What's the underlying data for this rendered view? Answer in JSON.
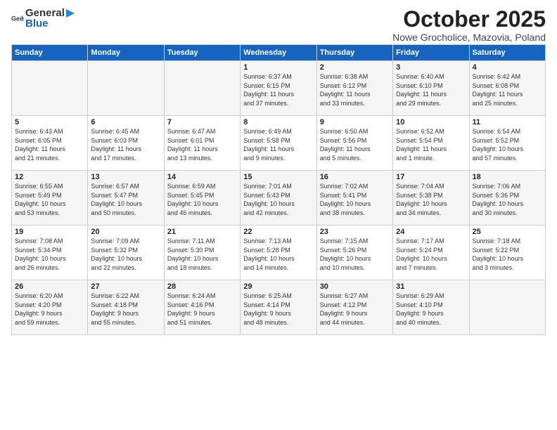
{
  "header": {
    "logo_general": "General",
    "logo_blue": "Blue",
    "month": "October 2025",
    "location": "Nowe Grocholice, Mazovia, Poland"
  },
  "days_of_week": [
    "Sunday",
    "Monday",
    "Tuesday",
    "Wednesday",
    "Thursday",
    "Friday",
    "Saturday"
  ],
  "weeks": [
    [
      {
        "day": "",
        "info": ""
      },
      {
        "day": "",
        "info": ""
      },
      {
        "day": "",
        "info": ""
      },
      {
        "day": "1",
        "info": "Sunrise: 6:37 AM\nSunset: 6:15 PM\nDaylight: 11 hours\nand 37 minutes."
      },
      {
        "day": "2",
        "info": "Sunrise: 6:38 AM\nSunset: 6:12 PM\nDaylight: 11 hours\nand 33 minutes."
      },
      {
        "day": "3",
        "info": "Sunrise: 6:40 AM\nSunset: 6:10 PM\nDaylight: 11 hours\nand 29 minutes."
      },
      {
        "day": "4",
        "info": "Sunrise: 6:42 AM\nSunset: 6:08 PM\nDaylight: 11 hours\nand 25 minutes."
      }
    ],
    [
      {
        "day": "5",
        "info": "Sunrise: 6:43 AM\nSunset: 6:05 PM\nDaylight: 11 hours\nand 21 minutes."
      },
      {
        "day": "6",
        "info": "Sunrise: 6:45 AM\nSunset: 6:03 PM\nDaylight: 11 hours\nand 17 minutes."
      },
      {
        "day": "7",
        "info": "Sunrise: 6:47 AM\nSunset: 6:01 PM\nDaylight: 11 hours\nand 13 minutes."
      },
      {
        "day": "8",
        "info": "Sunrise: 6:49 AM\nSunset: 5:58 PM\nDaylight: 11 hours\nand 9 minutes."
      },
      {
        "day": "9",
        "info": "Sunrise: 6:50 AM\nSunset: 5:56 PM\nDaylight: 11 hours\nand 5 minutes."
      },
      {
        "day": "10",
        "info": "Sunrise: 6:52 AM\nSunset: 5:54 PM\nDaylight: 11 hours\nand 1 minute."
      },
      {
        "day": "11",
        "info": "Sunrise: 6:54 AM\nSunset: 5:52 PM\nDaylight: 10 hours\nand 57 minutes."
      }
    ],
    [
      {
        "day": "12",
        "info": "Sunrise: 6:55 AM\nSunset: 5:49 PM\nDaylight: 10 hours\nand 53 minutes."
      },
      {
        "day": "13",
        "info": "Sunrise: 6:57 AM\nSunset: 5:47 PM\nDaylight: 10 hours\nand 50 minutes."
      },
      {
        "day": "14",
        "info": "Sunrise: 6:59 AM\nSunset: 5:45 PM\nDaylight: 10 hours\nand 46 minutes."
      },
      {
        "day": "15",
        "info": "Sunrise: 7:01 AM\nSunset: 5:43 PM\nDaylight: 10 hours\nand 42 minutes."
      },
      {
        "day": "16",
        "info": "Sunrise: 7:02 AM\nSunset: 5:41 PM\nDaylight: 10 hours\nand 38 minutes."
      },
      {
        "day": "17",
        "info": "Sunrise: 7:04 AM\nSunset: 5:38 PM\nDaylight: 10 hours\nand 34 minutes."
      },
      {
        "day": "18",
        "info": "Sunrise: 7:06 AM\nSunset: 5:36 PM\nDaylight: 10 hours\nand 30 minutes."
      }
    ],
    [
      {
        "day": "19",
        "info": "Sunrise: 7:08 AM\nSunset: 5:34 PM\nDaylight: 10 hours\nand 26 minutes."
      },
      {
        "day": "20",
        "info": "Sunrise: 7:09 AM\nSunset: 5:32 PM\nDaylight: 10 hours\nand 22 minutes."
      },
      {
        "day": "21",
        "info": "Sunrise: 7:11 AM\nSunset: 5:30 PM\nDaylight: 10 hours\nand 18 minutes."
      },
      {
        "day": "22",
        "info": "Sunrise: 7:13 AM\nSunset: 5:28 PM\nDaylight: 10 hours\nand 14 minutes."
      },
      {
        "day": "23",
        "info": "Sunrise: 7:15 AM\nSunset: 5:26 PM\nDaylight: 10 hours\nand 10 minutes."
      },
      {
        "day": "24",
        "info": "Sunrise: 7:17 AM\nSunset: 5:24 PM\nDaylight: 10 hours\nand 7 minutes."
      },
      {
        "day": "25",
        "info": "Sunrise: 7:18 AM\nSunset: 5:22 PM\nDaylight: 10 hours\nand 3 minutes."
      }
    ],
    [
      {
        "day": "26",
        "info": "Sunrise: 6:20 AM\nSunset: 4:20 PM\nDaylight: 9 hours\nand 59 minutes."
      },
      {
        "day": "27",
        "info": "Sunrise: 6:22 AM\nSunset: 4:18 PM\nDaylight: 9 hours\nand 55 minutes."
      },
      {
        "day": "28",
        "info": "Sunrise: 6:24 AM\nSunset: 4:16 PM\nDaylight: 9 hours\nand 51 minutes."
      },
      {
        "day": "29",
        "info": "Sunrise: 6:25 AM\nSunset: 4:14 PM\nDaylight: 9 hours\nand 48 minutes."
      },
      {
        "day": "30",
        "info": "Sunrise: 6:27 AM\nSunset: 4:12 PM\nDaylight: 9 hours\nand 44 minutes."
      },
      {
        "day": "31",
        "info": "Sunrise: 6:29 AM\nSunset: 4:10 PM\nDaylight: 9 hours\nand 40 minutes."
      },
      {
        "day": "",
        "info": ""
      }
    ]
  ]
}
